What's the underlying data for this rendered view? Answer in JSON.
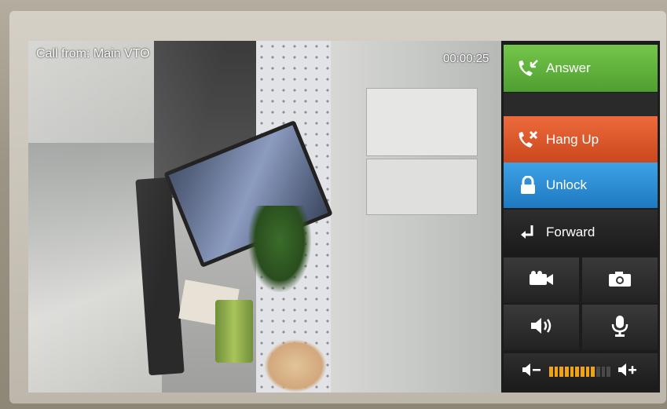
{
  "call": {
    "caller_label": "Call from: Main VTO",
    "duration": "00:00:25"
  },
  "buttons": {
    "answer": "Answer",
    "hang_up": "Hang Up",
    "unlock": "Unlock",
    "forward": "Forward"
  },
  "icons": {
    "answer": "phone-answer-icon",
    "hang_up": "phone-hangup-icon",
    "unlock": "lock-icon",
    "forward": "forward-arrow-icon",
    "record": "video-camera-icon",
    "snapshot": "camera-icon",
    "speaker": "speaker-icon",
    "microphone": "microphone-icon",
    "volume_down": "volume-down-icon",
    "volume_up": "volume-up-icon"
  },
  "volume": {
    "segments_total": 12,
    "level": 0.75
  },
  "colors": {
    "answer": "#5fb43a",
    "hang_up": "#dd5a2a",
    "unlock": "#2a8fd6",
    "volume_fill": "#f0a415"
  }
}
